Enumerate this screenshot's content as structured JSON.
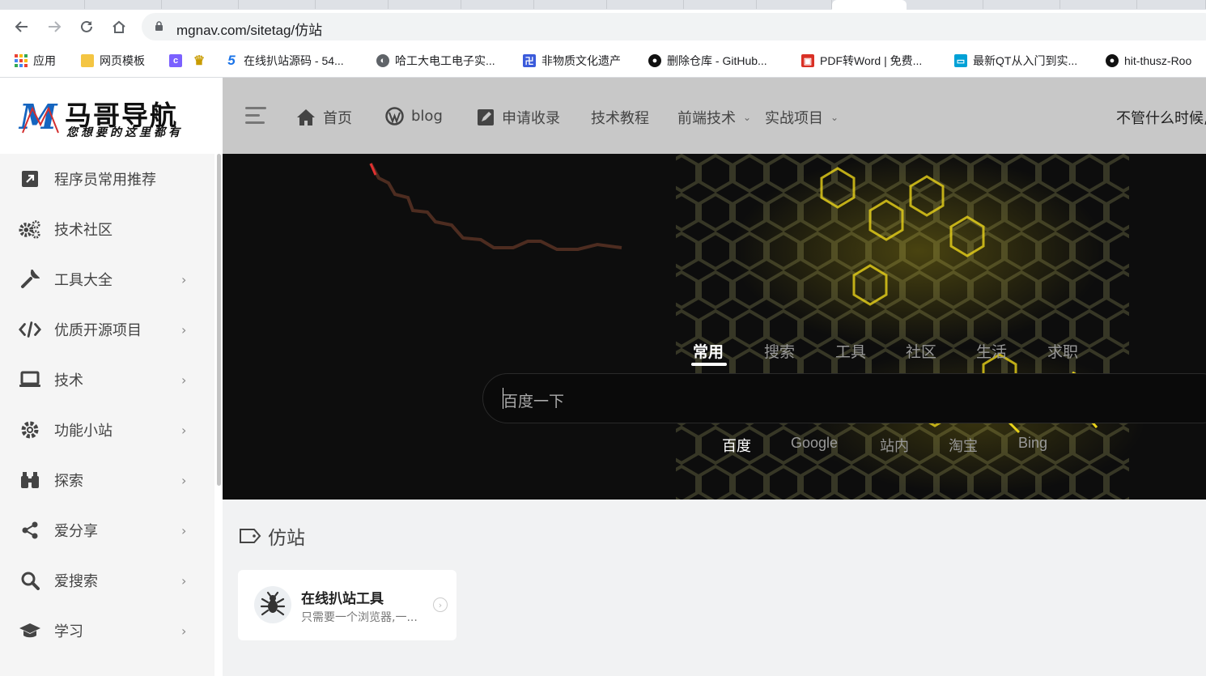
{
  "browser": {
    "url": "mgnav.com/sitetag/仿站",
    "bookmarks": [
      {
        "label": "应用",
        "icon": "apps-grid-icon",
        "color": "#4285f4"
      },
      {
        "label": "网页模板",
        "icon": "folder-icon",
        "color": "#f4c542"
      },
      {
        "label": "",
        "icon": "extension-icon",
        "color": "#7b61ff"
      },
      {
        "label": "",
        "icon": "trophy-icon",
        "color": "#c89b00"
      },
      {
        "label": "在线扒站源码 - 54...",
        "icon": "site-5-icon",
        "color": "#1a73e8"
      },
      {
        "label": "哈工大电工电子实...",
        "icon": "globe-icon",
        "color": "#5f6368"
      },
      {
        "label": "非物质文化遗产",
        "icon": "heritage-icon",
        "color": "#3b5bdb"
      },
      {
        "label": "删除仓库 - GitHub...",
        "icon": "github-icon",
        "color": "#111111"
      },
      {
        "label": "PDF转Word | 免费...",
        "icon": "pdf-icon",
        "color": "#d93025"
      },
      {
        "label": "最新QT从入门到实...",
        "icon": "bilibili-icon",
        "color": "#00a1d6"
      },
      {
        "label": "hit-thusz-Roo",
        "icon": "github-icon",
        "color": "#111111"
      }
    ]
  },
  "logo": {
    "mark": "M",
    "title": "马哥导航",
    "subtitle": "您想要的这里都有"
  },
  "sidebar": {
    "items": [
      {
        "label": "程序员常用推荐",
        "icon": "external-link-icon",
        "has_children": false
      },
      {
        "label": "技术社区",
        "icon": "cogs-icon",
        "has_children": false
      },
      {
        "label": "工具大全",
        "icon": "wrench-icon",
        "has_children": true
      },
      {
        "label": "优质开源项目",
        "icon": "code-icon",
        "has_children": true
      },
      {
        "label": "技术",
        "icon": "laptop-icon",
        "has_children": true
      },
      {
        "label": "功能小站",
        "icon": "gear-icon",
        "has_children": true
      },
      {
        "label": "探索",
        "icon": "binoculars-icon",
        "has_children": true
      },
      {
        "label": "爱分享",
        "icon": "share-icon",
        "has_children": true
      },
      {
        "label": "爱搜索",
        "icon": "search-icon",
        "has_children": true
      },
      {
        "label": "学习",
        "icon": "graduation-cap-icon",
        "has_children": true
      }
    ]
  },
  "header": {
    "nav": [
      {
        "label": "首页",
        "icon": "home-icon"
      },
      {
        "label": "blog",
        "icon": "wordpress-icon"
      },
      {
        "label": "申请收录",
        "icon": "edit-icon"
      },
      {
        "label": "技术教程",
        "icon": ""
      },
      {
        "label": "前端技术",
        "icon": "",
        "dropdown": true
      },
      {
        "label": "实战项目",
        "icon": "",
        "dropdown": true
      }
    ],
    "motto": "不管什么时候,"
  },
  "search": {
    "tabs": [
      "常用",
      "搜索",
      "工具",
      "社区",
      "生活",
      "求职"
    ],
    "active_tab": "常用",
    "placeholder": "百度一下",
    "engines": [
      "百度",
      "Google",
      "站内",
      "淘宝",
      "Bing"
    ],
    "active_engine": "百度"
  },
  "main": {
    "tag_title": "仿站",
    "cards": [
      {
        "title": "在线扒站工具",
        "description": "只需要一个浏览器,一..."
      }
    ]
  },
  "colors": {
    "header_bg": "#c8c8c8",
    "hero_bg": "#0d0d0d",
    "sidebar_bg": "#f5f5f5",
    "hex_yellow": "#e8d21a",
    "accent_red": "#e03030"
  }
}
